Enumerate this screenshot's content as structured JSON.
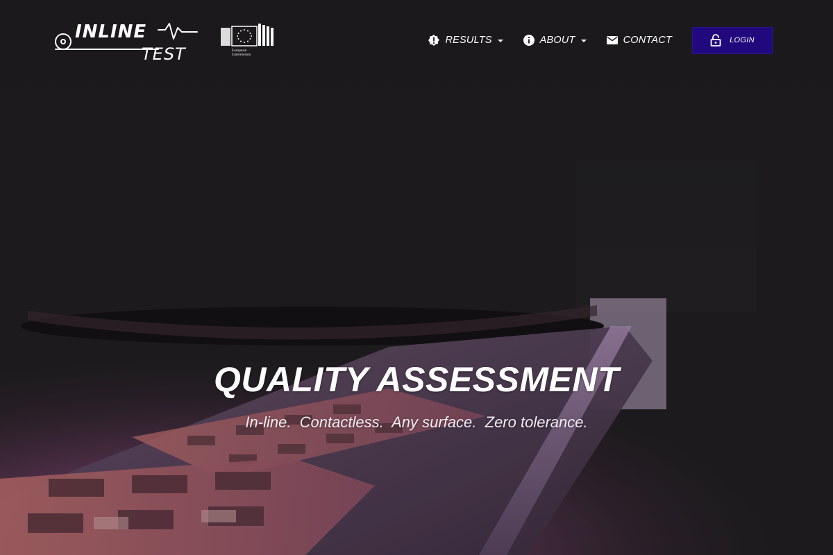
{
  "brand": {
    "logo_line1": "INLINE",
    "logo_line2": "TEST",
    "partner_logo_text_1": "European",
    "partner_logo_text_2": "Commission"
  },
  "nav": {
    "items": [
      {
        "label": "RESULTS",
        "icon": "exclamation-badge-icon",
        "dropdown": true
      },
      {
        "label": "ABOUT",
        "icon": "info-circle-icon",
        "dropdown": true
      },
      {
        "label": "CONTACT",
        "icon": "envelope-icon",
        "dropdown": false
      }
    ],
    "login_label": "LOGIN",
    "login_icon": "padlock-icon"
  },
  "hero": {
    "title": "QUALITY ASSESSMENT",
    "subtitle": "In-line.  Contactless.  Any surface.  Zero tolerance."
  },
  "colors": {
    "login_button": "#21097d",
    "text": "#ffffff",
    "background_dark": "#1e1c1f",
    "background_accent": "#8a4f7a"
  }
}
